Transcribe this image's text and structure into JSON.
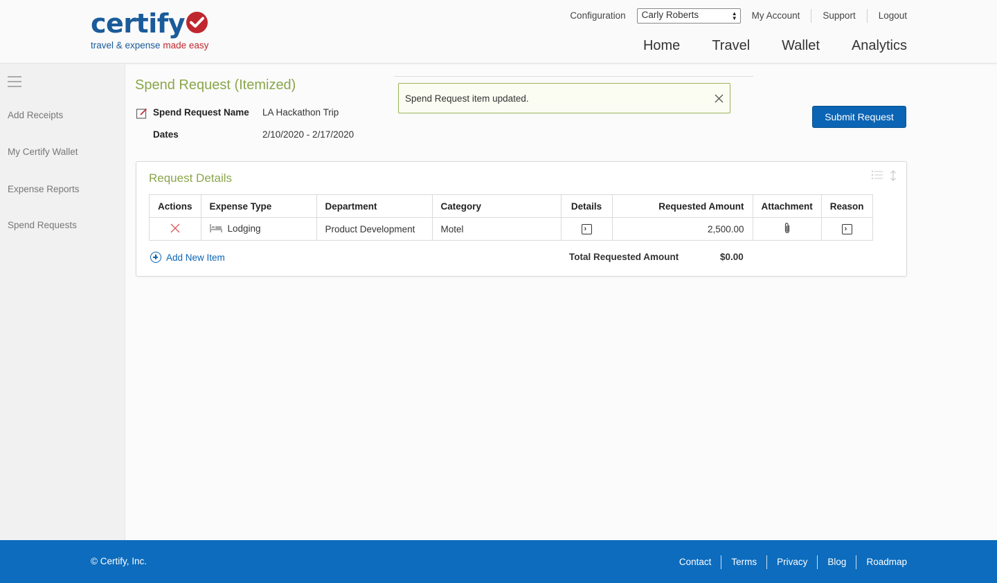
{
  "brand": {
    "name": "certify",
    "tagline_part1": "travel & expense",
    "tagline_part2": "made easy"
  },
  "topnav": {
    "configuration": "Configuration",
    "user_select_value": "Carly Roberts",
    "my_account": "My Account",
    "support": "Support",
    "logout": "Logout"
  },
  "mainnav": [
    "Home",
    "Travel",
    "Wallet",
    "Analytics"
  ],
  "sidebar": {
    "items": [
      "Add Receipts",
      "My Certify Wallet",
      "Expense Reports",
      "Spend Requests"
    ]
  },
  "page": {
    "title": "Spend Request (Itemized)",
    "name_label": "Spend Request Name",
    "name_value": "LA Hackathon Trip",
    "dates_label": "Dates",
    "dates_value": "2/10/2020 - 2/17/2020",
    "alert_message": "Spend Request item updated.",
    "submit_label": "Submit Request"
  },
  "request_details": {
    "title": "Request Details",
    "columns": [
      "Actions",
      "Expense Type",
      "Department",
      "Category",
      "Details",
      "Requested Amount",
      "Attachment",
      "Reason"
    ],
    "rows": [
      {
        "expense_type": "Lodging",
        "department": "Product Development",
        "category": "Motel",
        "requested_amount": "2,500.00"
      }
    ],
    "add_item_label": "Add New Item",
    "total_label": "Total Requested Amount",
    "total_value": "$0.00"
  },
  "footer": {
    "copyright": "© Certify, Inc.",
    "links": [
      "Contact",
      "Terms",
      "Privacy",
      "Blog",
      "Roadmap"
    ]
  },
  "colors": {
    "brand_blue": "#1a5b9a",
    "brand_red": "#c0262d",
    "accent_green": "#8aa64b",
    "primary_button": "#0b64b4",
    "footer_bg": "#0d6cbd"
  }
}
